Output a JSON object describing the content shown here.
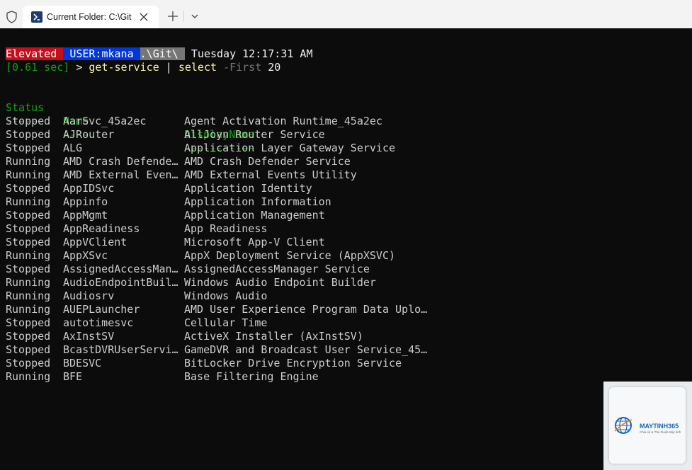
{
  "window": {
    "tab_title": "Current Folder: C:\\Git"
  },
  "prompt": {
    "elevated": "Elevated",
    "user": "USER:mkana",
    "path": ".\\Git\\",
    "datetime": "Tuesday 12:17:31 AM",
    "timing": "[0.61 sec]",
    "arrow": " > ",
    "cmd": "get-service",
    "pipe": " | ",
    "cmd2": "select",
    "param": "-First",
    "arg": "20"
  },
  "table": {
    "headers": {
      "status": "Status",
      "name": "Name",
      "display": "DisplayName"
    },
    "underlines": {
      "status": "------",
      "name": "----",
      "display": "-----------"
    },
    "rows": [
      {
        "status": "Stopped",
        "name": "AarSvc_45a2ec",
        "display": "Agent Activation Runtime_45a2ec"
      },
      {
        "status": "Stopped",
        "name": "AJRouter",
        "display": "AllJoyn Router Service"
      },
      {
        "status": "Stopped",
        "name": "ALG",
        "display": "Application Layer Gateway Service"
      },
      {
        "status": "Running",
        "name": "AMD Crash Defende…",
        "display": "AMD Crash Defender Service"
      },
      {
        "status": "Running",
        "name": "AMD External Even…",
        "display": "AMD External Events Utility"
      },
      {
        "status": "Stopped",
        "name": "AppIDSvc",
        "display": "Application Identity"
      },
      {
        "status": "Running",
        "name": "Appinfo",
        "display": "Application Information"
      },
      {
        "status": "Stopped",
        "name": "AppMgmt",
        "display": "Application Management"
      },
      {
        "status": "Stopped",
        "name": "AppReadiness",
        "display": "App Readiness"
      },
      {
        "status": "Stopped",
        "name": "AppVClient",
        "display": "Microsoft App-V Client"
      },
      {
        "status": "Running",
        "name": "AppXSvc",
        "display": "AppX Deployment Service (AppXSVC)"
      },
      {
        "status": "Stopped",
        "name": "AssignedAccessMan…",
        "display": "AssignedAccessManager Service"
      },
      {
        "status": "Running",
        "name": "AudioEndpointBuil…",
        "display": "Windows Audio Endpoint Builder"
      },
      {
        "status": "Running",
        "name": "Audiosrv",
        "display": "Windows Audio"
      },
      {
        "status": "Running",
        "name": "AUEPLauncher",
        "display": "AMD User Experience Program Data Uplo…"
      },
      {
        "status": "Stopped",
        "name": "autotimesvc",
        "display": "Cellular Time"
      },
      {
        "status": "Stopped",
        "name": "AxInstSV",
        "display": "ActiveX Installer (AxInstSV)"
      },
      {
        "status": "Stopped",
        "name": "BcastDVRUserServi…",
        "display": "GameDVR and Broadcast User Service_45…"
      },
      {
        "status": "Stopped",
        "name": "BDESVC",
        "display": "BitLocker Drive Encryption Service"
      },
      {
        "status": "Running",
        "name": "BFE",
        "display": "Base Filtering Engine"
      }
    ]
  },
  "watermark": {
    "brand": "MAYTINH365",
    "tagline": "Chia sẻ & Thủ thuật Máy tính"
  },
  "colors": {
    "terminal_bg": "#0c0c0c",
    "elevated_bg": "#c50f1f",
    "user_bg": "#0037da",
    "path_bg": "#767676",
    "header_green": "#13a10e"
  },
  "icons": {
    "shield": "shield-icon",
    "powershell": "powershell-icon",
    "close": "close-icon",
    "new_tab": "plus-icon",
    "dropdown": "chevron-down-icon"
  }
}
